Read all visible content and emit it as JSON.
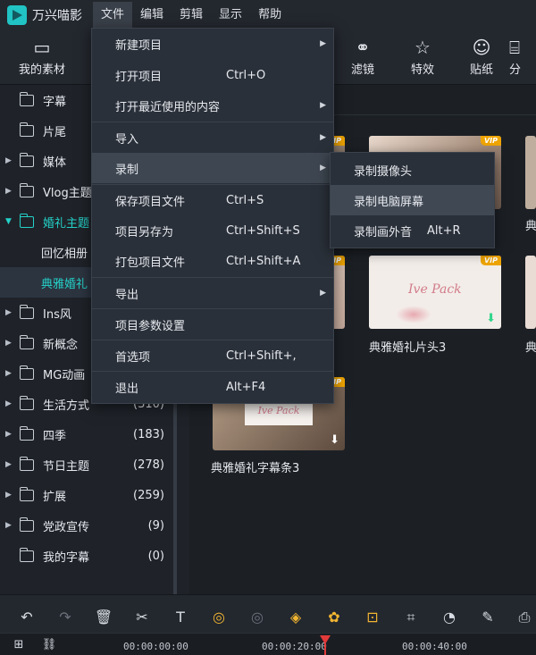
{
  "app": {
    "title": "万兴喵影"
  },
  "menubar": [
    "文件",
    "编辑",
    "剪辑",
    "显示",
    "帮助"
  ],
  "toolbar": {
    "my_assets": "我的素材",
    "filters": "滤镜",
    "effects": "特效",
    "stickers": "贴纸",
    "partial": "分"
  },
  "sidebar": {
    "items": [
      {
        "label": "字幕",
        "count": ""
      },
      {
        "label": "片尾",
        "count": ""
      },
      {
        "label": "媒体",
        "count": ""
      },
      {
        "label": "Vlog主题",
        "count": ""
      },
      {
        "label": "婚礼主题",
        "count": ""
      },
      {
        "label": "回忆相册",
        "count": ""
      },
      {
        "label": "典雅婚礼",
        "count": ""
      },
      {
        "label": "Ins风",
        "count": ""
      },
      {
        "label": "新概念",
        "count": ""
      },
      {
        "label": "MG动画",
        "count": ""
      },
      {
        "label": "生活方式",
        "count": "(310)"
      },
      {
        "label": "四季",
        "count": "(183)"
      },
      {
        "label": "节日主题",
        "count": "(278)"
      },
      {
        "label": "扩展",
        "count": "(259)"
      },
      {
        "label": "党政宣传",
        "count": "(9)"
      },
      {
        "label": "我的字幕",
        "count": "(0)"
      }
    ]
  },
  "file_menu": {
    "items": [
      {
        "label": "新建项目",
        "shortcut": ""
      },
      {
        "label": "打开项目",
        "shortcut": "Ctrl+O"
      },
      {
        "label": "打开最近使用的内容",
        "shortcut": ""
      },
      {
        "label": "导入",
        "shortcut": ""
      },
      {
        "label": "录制",
        "shortcut": ""
      },
      {
        "label": "保存项目文件",
        "shortcut": "Ctrl+S"
      },
      {
        "label": "项目另存为",
        "shortcut": "Ctrl+Shift+S"
      },
      {
        "label": "打包项目文件",
        "shortcut": "Ctrl+Shift+A"
      },
      {
        "label": "导出",
        "shortcut": ""
      },
      {
        "label": "项目参数设置",
        "shortcut": ""
      },
      {
        "label": "首选项",
        "shortcut": "Ctrl+Shift+,"
      },
      {
        "label": "退出",
        "shortcut": "Alt+F4"
      }
    ]
  },
  "record_menu": {
    "items": [
      {
        "label": "录制摄像头",
        "shortcut": ""
      },
      {
        "label": "录制电脑屏幕",
        "shortcut": ""
      },
      {
        "label": "录制画外音",
        "shortcut": "Alt+R"
      }
    ]
  },
  "content": {
    "vip_badge": "VIP",
    "thumb_text": "Ive Pack",
    "labels": {
      "t4": "典雅婚礼片头3",
      "t5": "典",
      "t6": "典雅婚礼字幕条3",
      "t7": "典"
    }
  },
  "timeline": {
    "t0": "00:00:00:00",
    "t1": "00:00:20:00",
    "t2": "00:00:40:00"
  },
  "colors": {
    "accent": "#24d1c8",
    "vip": "#f0a500",
    "playhead": "#e23a3a"
  }
}
